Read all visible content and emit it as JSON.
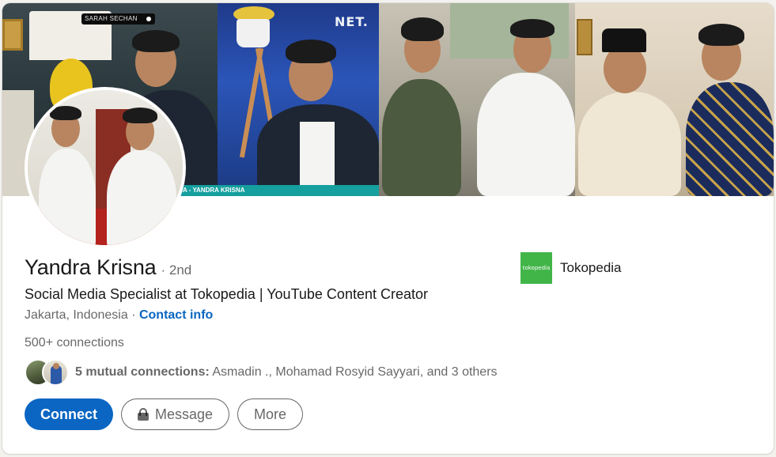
{
  "cover": {
    "tv_tag": "SARAH SECHAN",
    "network_logo": "NET.",
    "lower_third": "A - YANDRA KRISNA"
  },
  "profile": {
    "name": "Yandra Krisna",
    "degree": "· 2nd",
    "headline": "Social Media Specialist at Tokopedia | YouTube Content Creator",
    "location": "Jakarta, Indonesia",
    "location_separator": " · ",
    "contact_info": "Contact info",
    "connections": "500+ connections"
  },
  "mutual": {
    "label": "5 mutual connections:",
    "names": " Asmadin ., Mohamad Rosyid Sayyari, and 3 others"
  },
  "actions": {
    "connect": "Connect",
    "message": "Message",
    "more": "More"
  },
  "company": {
    "logo_text": "tokopedia",
    "name": "Tokopedia"
  },
  "colors": {
    "accent": "#0a66c2",
    "company_brand": "#42b549"
  }
}
